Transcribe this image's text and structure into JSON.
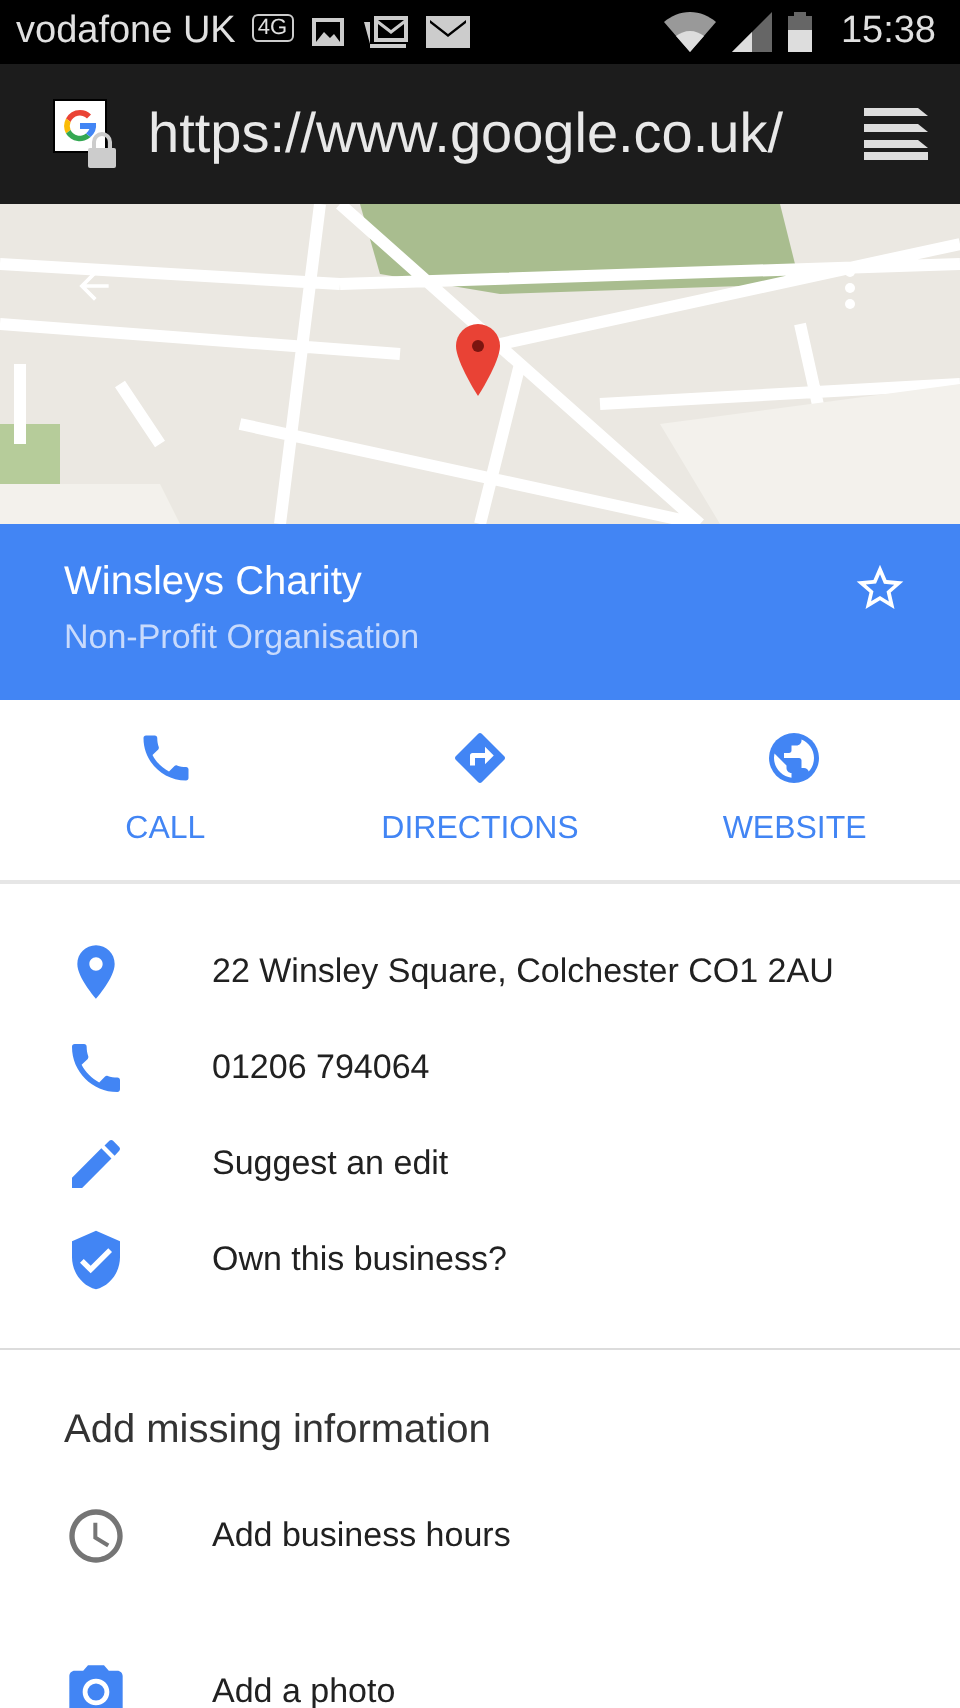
{
  "status_bar": {
    "carrier": "vodafone UK",
    "network": "4G",
    "time": "15:38"
  },
  "browser": {
    "url": "https://www.google.co.uk/"
  },
  "place": {
    "name": "Winsleys Charity",
    "category": "Non-Profit Organisation"
  },
  "actions": [
    {
      "kind": "call",
      "label": "CALL"
    },
    {
      "kind": "directions",
      "label": "DIRECTIONS"
    },
    {
      "kind": "website",
      "label": "WEBSITE"
    }
  ],
  "details": [
    {
      "kind": "address",
      "text": "22 Winsley Square, Colchester CO1 2AU"
    },
    {
      "kind": "phone",
      "text": "01206 794064"
    },
    {
      "kind": "edit",
      "text": "Suggest an edit"
    },
    {
      "kind": "owner",
      "text": "Own this business?"
    }
  ],
  "missing_info": {
    "heading": "Add missing information",
    "items": [
      {
        "kind": "hours",
        "text": "Add business hours"
      },
      {
        "text": "Add a photo"
      }
    ]
  }
}
